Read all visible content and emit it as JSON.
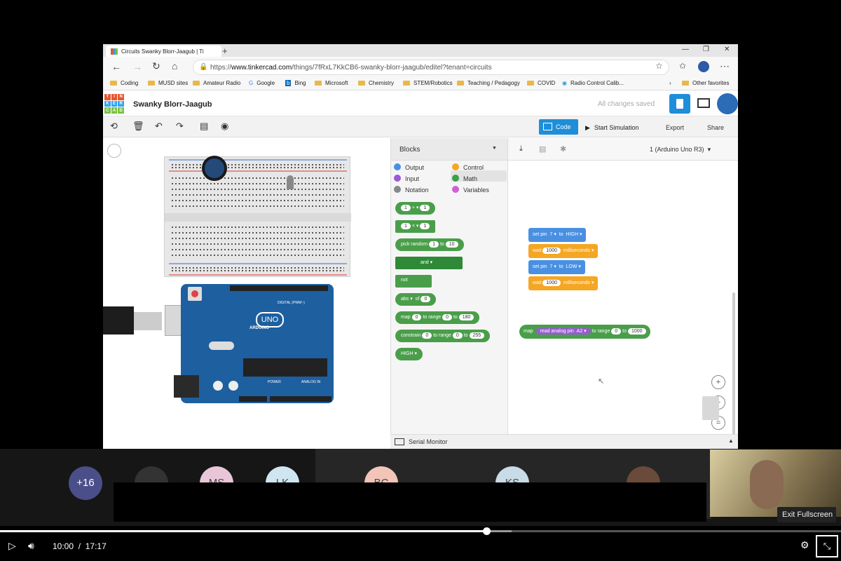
{
  "browser": {
    "tab_title": "Circuits Swanky Blorr-Jaagub | Ti",
    "url_prefix": "https://",
    "url_host": "www.tinkercad.com",
    "url_path": "/things/7fRxL7KkCB6-swanky-blorr-jaagub/editel?tenant=circuits",
    "bookmarks": [
      "Coding",
      "MUSD sites",
      "Amateur Radio",
      "Google",
      "Bing",
      "Microsoft",
      "Chemistry",
      "STEM/Robotics",
      "Teaching / Pedagogy",
      "COVID",
      "Radio Control Calib..."
    ],
    "other_favorites": "Other favorites"
  },
  "app": {
    "logo_letters": [
      "T",
      "I",
      "N",
      "K",
      "E",
      "R",
      "C",
      "A",
      "D"
    ],
    "project_title": "Swanky Blorr-Jaagub",
    "save_status": "All changes saved",
    "code_button": "Code",
    "start_sim_button": "Start Simulation",
    "export_button": "Export",
    "share_button": "Share"
  },
  "blocks_panel": {
    "dropdown": "Blocks",
    "categories": [
      "Output",
      "Control",
      "Input",
      "Math",
      "Notation",
      "Variables"
    ],
    "category_colors": [
      "#4a90e2",
      "#f5a623",
      "#9b59d6",
      "#3aa04a",
      "#888888",
      "#d35fd6"
    ],
    "selected_category": "Math",
    "b1": [
      "1",
      "+",
      "1"
    ],
    "b2": [
      "1",
      "<",
      "1"
    ],
    "b3": [
      "pick random",
      "1",
      "to",
      "10"
    ],
    "b4": "and",
    "b5": "not",
    "b6": [
      "abs",
      "of",
      "0"
    ],
    "b7": [
      "map",
      "0",
      "to range",
      "0",
      "to",
      "180"
    ],
    "b8": [
      "constrain",
      "0",
      "to range",
      "0",
      "to",
      "255"
    ],
    "b9": "HIGH"
  },
  "code_panel": {
    "device": "1 (Arduino Uno R3)",
    "set_pin_1": [
      "set pin",
      "7",
      "to",
      "HIGH"
    ],
    "wait_1": [
      "wait",
      "1000",
      "milliseconds"
    ],
    "set_pin_2": [
      "set pin",
      "7",
      "to",
      "LOW"
    ],
    "wait_2": [
      "wait",
      "1000",
      "milliseconds"
    ],
    "map_block": [
      "map",
      "read analog pin",
      "A2",
      "to range",
      "0",
      "to",
      "1000"
    ],
    "serial_monitor": "Serial Monitor"
  },
  "arduino": {
    "brand": "ARDUINO",
    "model": "UNO",
    "digital_label": "DIGITAL (PWM~)",
    "power_label": "POWER",
    "analog_label": "ANALOG IN"
  },
  "meeting": {
    "more_participants": "+16",
    "avatars": [
      "MS",
      "LK",
      "BC",
      "KS"
    ],
    "tooltip": "Exit Fullscreen"
  },
  "player": {
    "current_time": "10:00",
    "separator": "/",
    "duration": "17:17",
    "progress_fraction": 0.578
  }
}
